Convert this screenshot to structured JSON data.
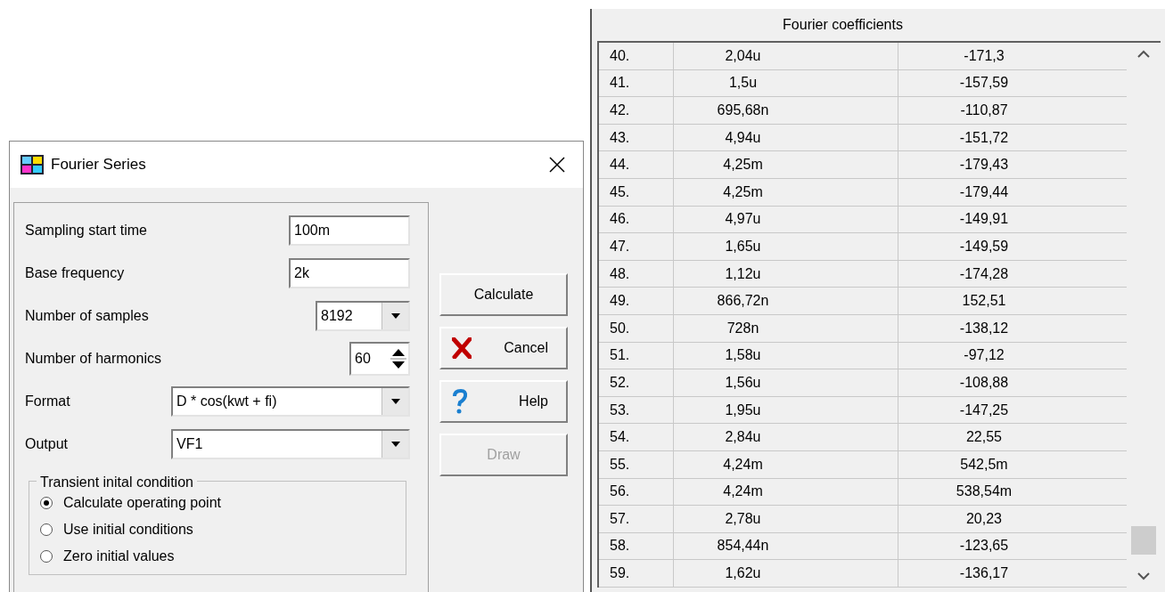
{
  "dialog": {
    "title": "Fourier Series",
    "fields": [
      {
        "kind": "text",
        "label": "Sampling start time",
        "value": "100m"
      },
      {
        "kind": "text",
        "label": "Base frequency",
        "value": "2k"
      },
      {
        "kind": "combo",
        "label": "Number of samples",
        "value": "8192"
      },
      {
        "kind": "spin",
        "label": "Number of harmonics",
        "value": "60"
      },
      {
        "kind": "wide",
        "label": "Format",
        "value": "D * cos(kwt + fi)"
      },
      {
        "kind": "wide",
        "label": "Output",
        "value": "VF1"
      }
    ],
    "group": {
      "title": "Transient inital condition",
      "options": [
        {
          "label": "Calculate operating point",
          "selected": true
        },
        {
          "label": "Use initial conditions",
          "selected": false
        },
        {
          "label": "Zero initial values",
          "selected": false
        }
      ]
    },
    "buttons": [
      {
        "kind": "plain",
        "label": "Calculate",
        "disabled": false
      },
      {
        "kind": "cancel",
        "label": "Cancel",
        "disabled": false
      },
      {
        "kind": "help",
        "label": "Help",
        "disabled": false
      },
      {
        "kind": "plain",
        "label": "Draw",
        "disabled": true
      }
    ]
  },
  "coefficients": {
    "title": "Fourier coefficients",
    "rows": [
      [
        "40.",
        "2,04u",
        "-171,3"
      ],
      [
        "41.",
        "1,5u",
        "-157,59"
      ],
      [
        "42.",
        "695,68n",
        "-110,87"
      ],
      [
        "43.",
        "4,94u",
        "-151,72"
      ],
      [
        "44.",
        "4,25m",
        "-179,43"
      ],
      [
        "45.",
        "4,25m",
        "-179,44"
      ],
      [
        "46.",
        "4,97u",
        "-149,91"
      ],
      [
        "47.",
        "1,65u",
        "-149,59"
      ],
      [
        "48.",
        "1,12u",
        "-174,28"
      ],
      [
        "49.",
        "866,72n",
        "152,51"
      ],
      [
        "50.",
        "728n",
        "-138,12"
      ],
      [
        "51.",
        "1,58u",
        "-97,12"
      ],
      [
        "52.",
        "1,56u",
        "-108,88"
      ],
      [
        "53.",
        "1,95u",
        "-147,25"
      ],
      [
        "54.",
        "2,84u",
        "22,55"
      ],
      [
        "55.",
        "4,24m",
        "542,5m"
      ],
      [
        "56.",
        "4,24m",
        "538,54m"
      ],
      [
        "57.",
        "2,78u",
        "20,23"
      ],
      [
        "58.",
        "854,44n",
        "-123,65"
      ],
      [
        "59.",
        "1,62u",
        "-136,17"
      ]
    ]
  }
}
